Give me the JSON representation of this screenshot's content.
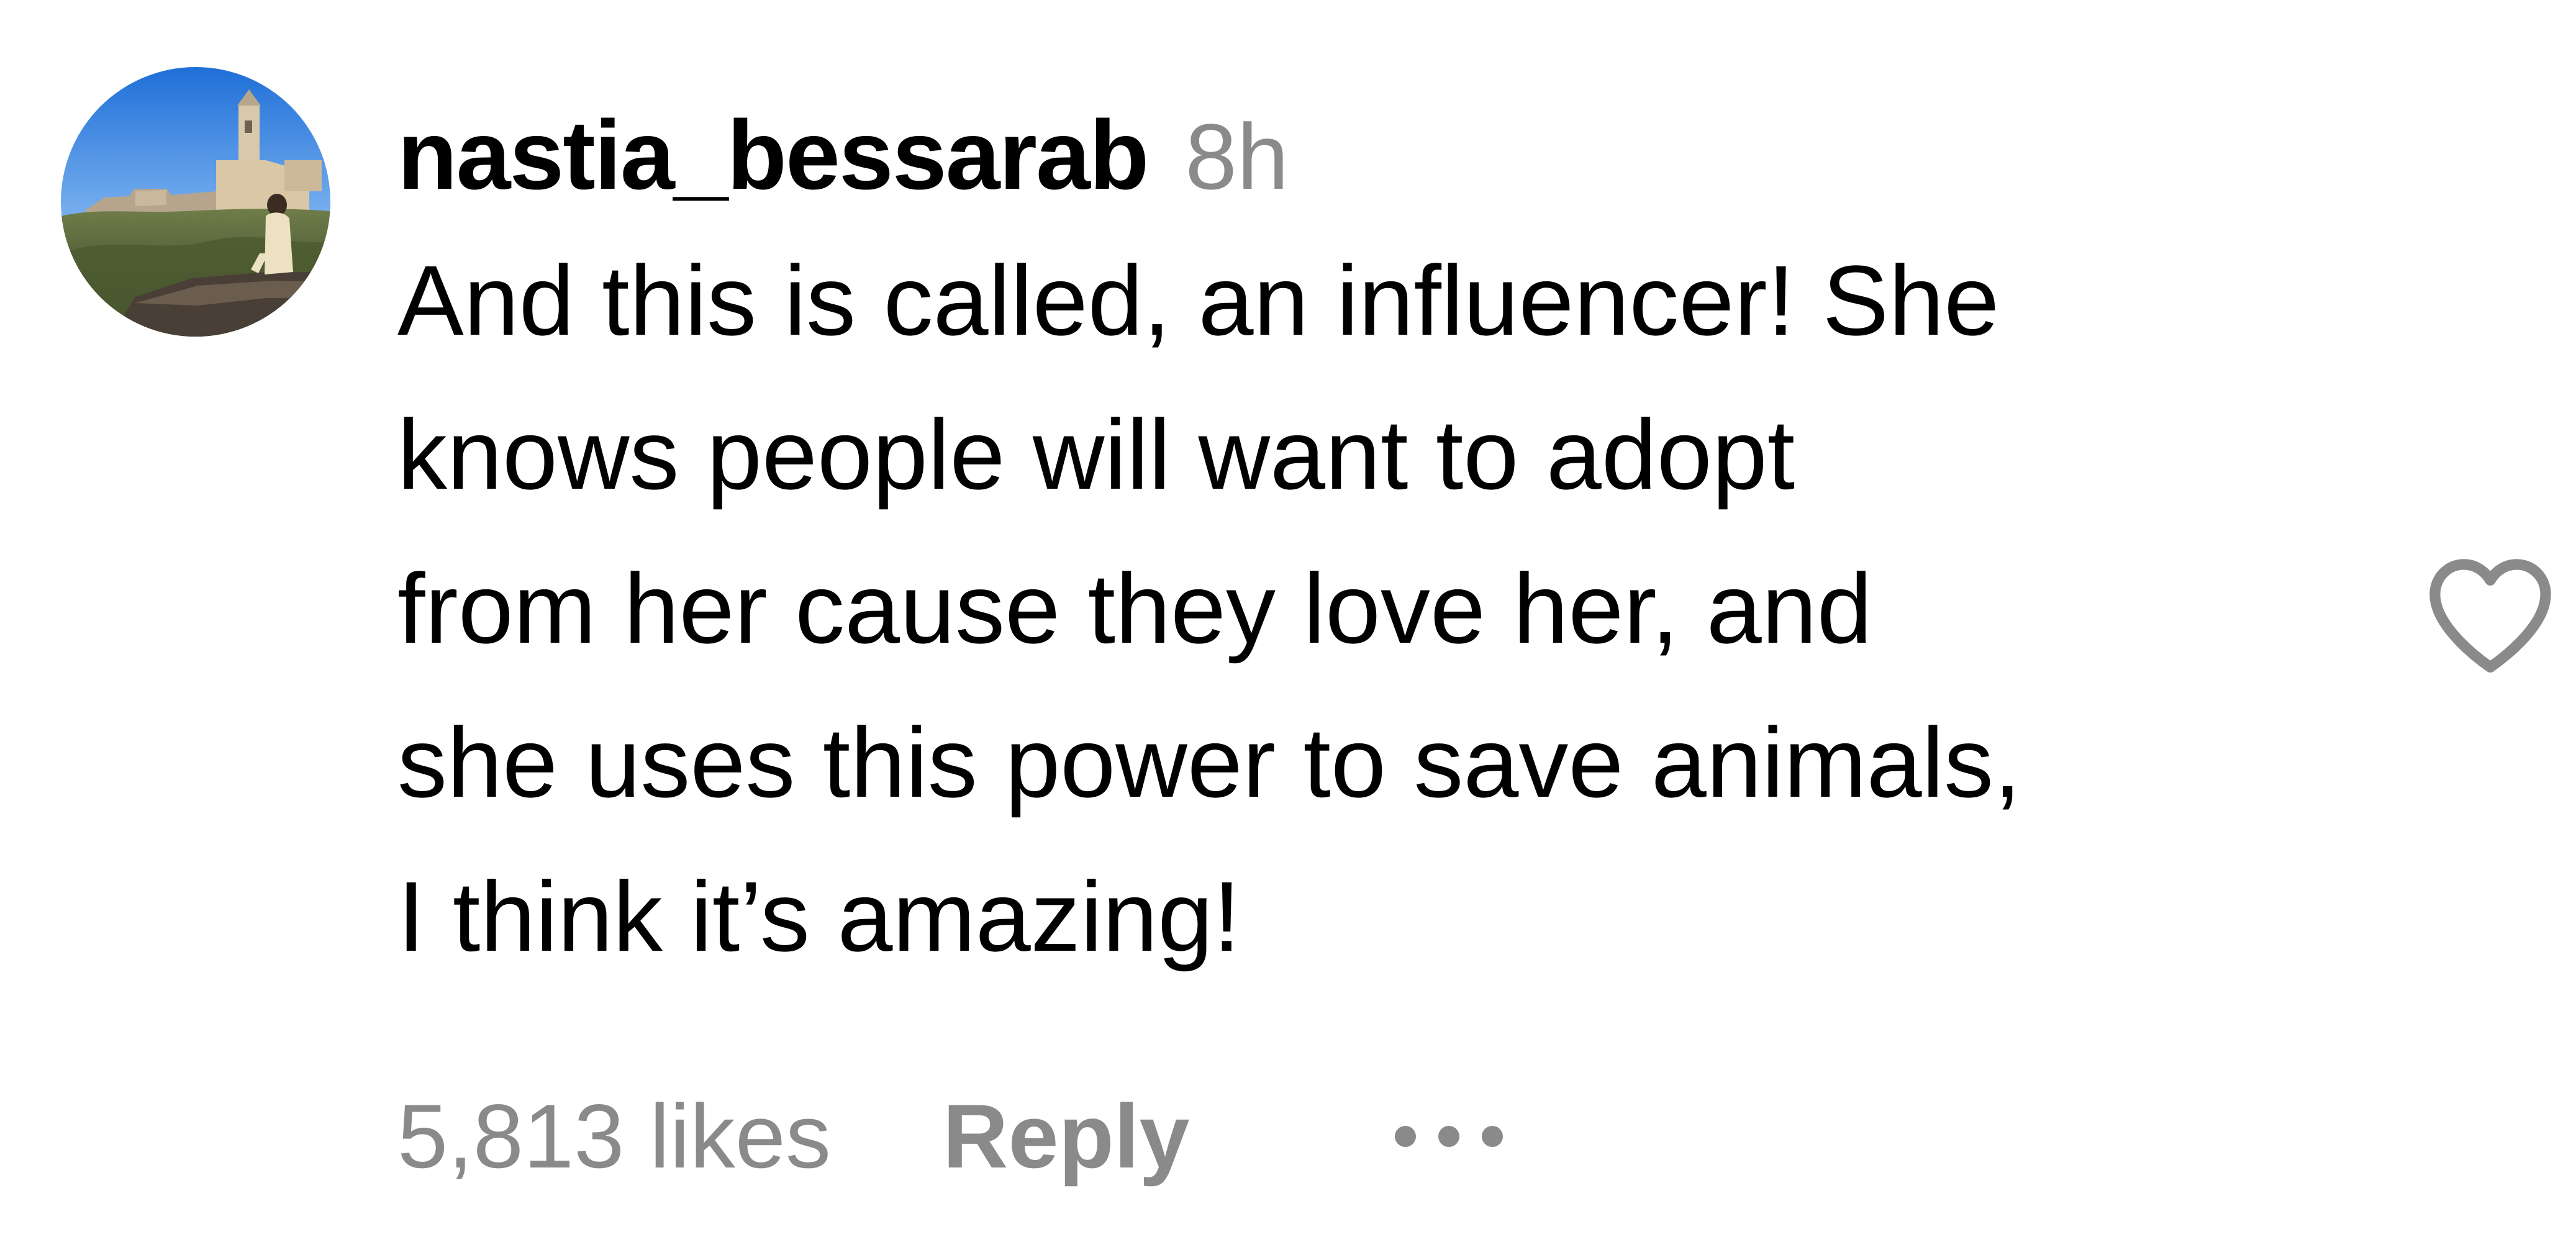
{
  "comment": {
    "username": "nastia_bessarab",
    "timestamp": "8h",
    "text_lines": [
      "And this is called, an influencer! She",
      "knows people will want to adopt",
      "from her cause they love her, and",
      "she uses this power to save animals,",
      "I think it’s amazing!"
    ],
    "likes": "5,813 likes",
    "reply_label": "Reply",
    "avatar_icon": "avatar-photo",
    "like_icon": "heart-outline-icon",
    "more_icon": "more-options-icon"
  },
  "colors": {
    "text_primary": "#000000",
    "text_secondary": "#8a8a8a",
    "icon": "#8a8a8a",
    "background": "#ffffff"
  }
}
